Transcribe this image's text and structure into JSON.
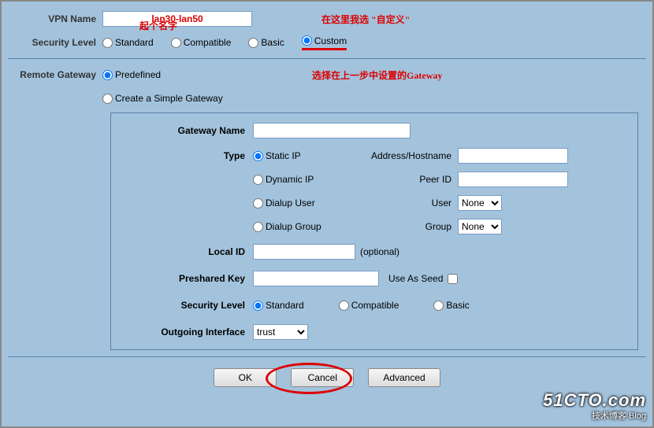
{
  "top": {
    "vpnNameLabel": "VPN Name",
    "vpnNameValue": "lan30-lan50",
    "ann1": "起个名字",
    "ann2": "在这里我选 \"自定义\"",
    "secLevelLabel": "Security Level",
    "secOptions": [
      "Standard",
      "Compatible",
      "Basic",
      "Custom"
    ]
  },
  "remote": {
    "label": "Remote Gateway",
    "opt1": "Predefined",
    "opt2": "Create a Simple Gateway",
    "ann": "选择在上一步中设置的Gateway"
  },
  "gateway": {
    "nameLabel": "Gateway Name",
    "typeLabel": "Type",
    "typeOptions": [
      "Static IP",
      "Dynamic IP",
      "Dialup User",
      "Dialup Group"
    ],
    "addrLabel": "Address/Hostname",
    "peerLabel": "Peer ID",
    "userLabel": "User",
    "groupLabel": "Group",
    "selNone": "None",
    "localIdLabel": "Local ID",
    "optional": "(optional)",
    "pskLabel": "Preshared Key",
    "useSeed": "Use As Seed",
    "secLevelLabel": "Security Level",
    "secOptions": [
      "Standard",
      "Compatible",
      "Basic"
    ],
    "outIfaceLabel": "Outgoing Interface",
    "outIfaceVal": "trust"
  },
  "buttons": {
    "ok": "OK",
    "cancel": "Cancel",
    "advanced": "Advanced"
  },
  "watermark": {
    "line1": "51CTO.com",
    "line2": "技术博客  Blog"
  }
}
